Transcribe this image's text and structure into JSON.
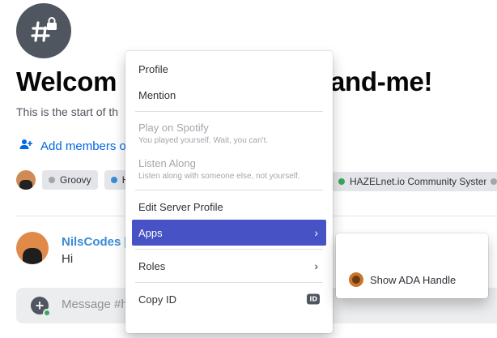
{
  "channel": {
    "welcome_left": "Welcom",
    "welcome_right": "and-me!",
    "start_text": "This is the start of th",
    "add_members": "Add members o"
  },
  "bots": [
    {
      "name": "Groovy",
      "color": "#a3a6aa"
    },
    {
      "name": "H",
      "color": "#3a8cd6"
    },
    {
      "name": "HAZELnet.io Community System",
      "color": "#3ba55c"
    }
  ],
  "message": {
    "author": "NilsCodes [",
    "text": "Hi"
  },
  "composer": {
    "placeholder": "Message #h"
  },
  "context_menu": {
    "profile": "Profile",
    "mention": "Mention",
    "play_spotify": "Play on Spotify",
    "play_spotify_sub": "You played yourself. Wait, you can't.",
    "listen_along": "Listen Along",
    "listen_along_sub": "Listen along with someone else, not yourself.",
    "edit_server_profile": "Edit Server Profile",
    "apps": "Apps",
    "roles": "Roles",
    "copy_id": "Copy ID",
    "id_badge": "ID"
  },
  "submenu": {
    "show_ada_handle": "Show ADA Handle"
  },
  "colors": {
    "accent": "#4752c4",
    "link": "#0068e0",
    "author": "#3a8cd6",
    "online": "#3ba55c"
  }
}
